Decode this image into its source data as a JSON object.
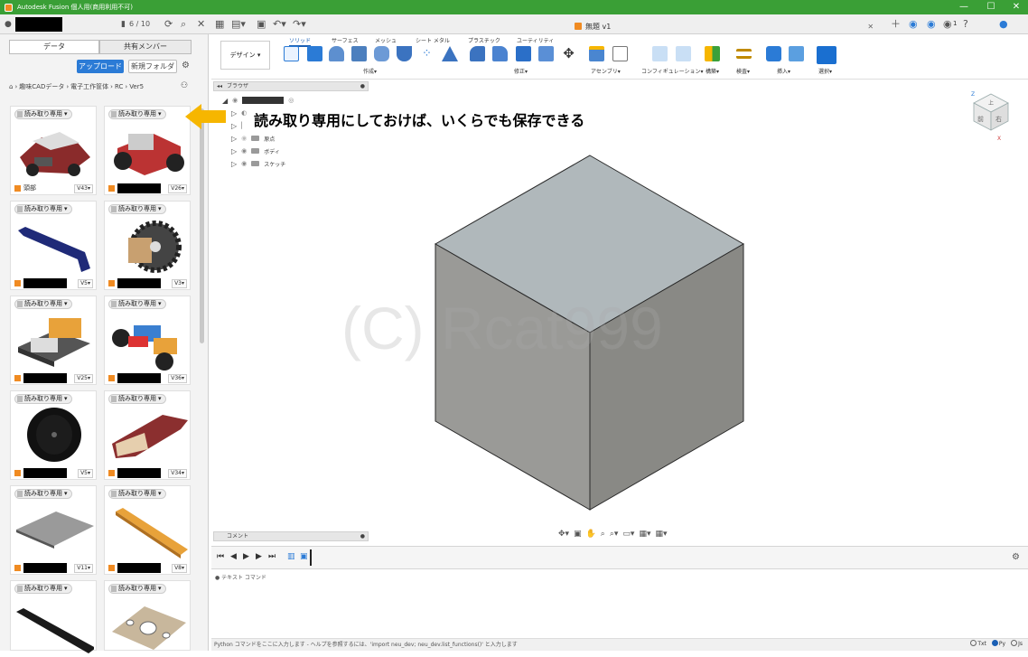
{
  "titlebar": {
    "title": "Autodesk Fusion 個人用(商用利用不可)",
    "minimize": "—",
    "maximize": "☐",
    "close": "✕"
  },
  "quickbar": {
    "counter": "6 / 10",
    "notifications": "1"
  },
  "document": {
    "title": "無題 v1"
  },
  "left_panel": {
    "tab_data": "データ",
    "tab_members": "共有メンバー",
    "upload_label": "アップロード",
    "new_folder_label": "新規フォルダ",
    "breadcrumb": [
      "趣味CADデータ",
      "電子工作筐体",
      "RC",
      "Ver5"
    ],
    "cards": [
      {
        "badge": "読み取り専用",
        "name": "頭部",
        "version": "V43",
        "redacted": false
      },
      {
        "badge": "読み取り専用",
        "name": "",
        "version": "V26",
        "redacted": true
      },
      {
        "badge": "読み取り専用",
        "name": "",
        "version": "V5",
        "redacted": true
      },
      {
        "badge": "読み取り専用",
        "name": "",
        "version": "V3",
        "redacted": true
      },
      {
        "badge": "読み取り専用",
        "name": "",
        "version": "V25",
        "redacted": true
      },
      {
        "badge": "読み取り専用",
        "name": "",
        "version": "V36",
        "redacted": true
      },
      {
        "badge": "読み取り専用",
        "name": "",
        "version": "V5",
        "redacted": true
      },
      {
        "badge": "読み取り専用",
        "name": "",
        "version": "V34",
        "redacted": true
      },
      {
        "badge": "読み取り専用",
        "name": "",
        "version": "V11",
        "redacted": true
      },
      {
        "badge": "読み取り専用",
        "name": "",
        "version": "V8",
        "redacted": true
      },
      {
        "badge": "読み取り専用",
        "name": "",
        "version": "",
        "redacted": false
      },
      {
        "badge": "読み取り専用",
        "name": "",
        "version": "",
        "redacted": false
      }
    ]
  },
  "ribbon": {
    "workspace": "デザイン",
    "tabs": [
      "ソリッド",
      "サーフェス",
      "メッシュ",
      "シート メタル",
      "プラスチック",
      "ユーティリティ"
    ],
    "groups": [
      "作成",
      "修正",
      "アセンブリ",
      "コンフィギュレーション",
      "構築",
      "検査",
      "挿入",
      "選択"
    ]
  },
  "browser": {
    "title": "ブラウザ",
    "items": [
      "原点",
      "ボディ",
      "スケッチ"
    ]
  },
  "annotation": {
    "text": "読み取り専用にしておけば、いくらでも保存できる"
  },
  "watermark": "(C) Rcat999",
  "comments": {
    "title": "コメント"
  },
  "text_command": {
    "title": "テキスト コマンド",
    "prompt": "Python コマンドをここに入力します - ヘルプを参照するには、'import neu_dev; neu_dev.list_functions()' と入力します",
    "opt_txt": "Txt",
    "opt_py": "Py",
    "opt_js": "Js"
  },
  "viewcube": {
    "front": "前",
    "right": "右",
    "z": "Z",
    "x": "X",
    "top": "上"
  },
  "colors": {
    "titlebar": "#3a9f36",
    "accent": "#2b7bd6",
    "annotation_arrow": "#f6b600",
    "cube_top": "#b0b8bb",
    "cube_left": "#9a9a97",
    "cube_right": "#8a8a86"
  }
}
